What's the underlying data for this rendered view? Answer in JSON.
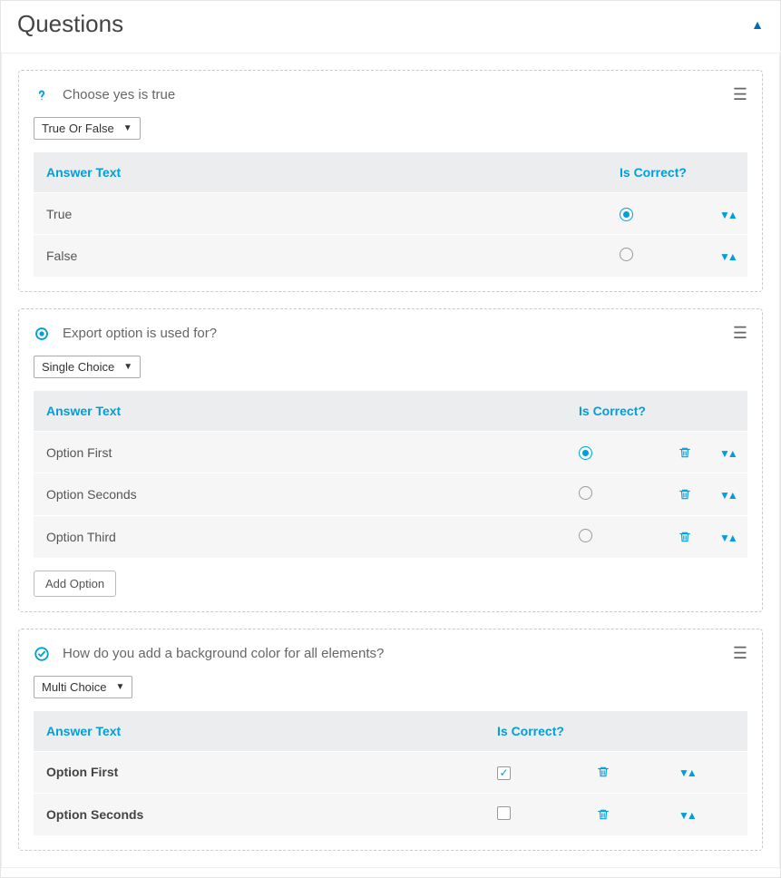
{
  "panel": {
    "title": "Questions"
  },
  "headers": {
    "answer_text": "Answer Text",
    "is_correct": "Is Correct?"
  },
  "buttons": {
    "add_option": "Add Option"
  },
  "questions": [
    {
      "icon": "question",
      "title": "Choose yes is true",
      "type_label": "True Or False",
      "selector": "radio",
      "deletable": false,
      "answers": [
        {
          "text": "True",
          "correct": true
        },
        {
          "text": "False",
          "correct": false
        }
      ]
    },
    {
      "icon": "radio",
      "title": "Export option is used for?",
      "type_label": "Single Choice",
      "selector": "radio",
      "deletable": true,
      "show_add": true,
      "answers": [
        {
          "text": "Option First",
          "correct": true
        },
        {
          "text": "Option Seconds",
          "correct": false
        },
        {
          "text": "Option Third",
          "correct": false
        }
      ]
    },
    {
      "icon": "check",
      "title": "How do you add a background color for all  elements?",
      "type_label": "Multi Choice",
      "selector": "checkbox",
      "deletable": true,
      "narrow": true,
      "bold_rows": true,
      "answers": [
        {
          "text": "Option First",
          "correct": true
        },
        {
          "text": "Option Seconds",
          "correct": false
        }
      ]
    }
  ]
}
